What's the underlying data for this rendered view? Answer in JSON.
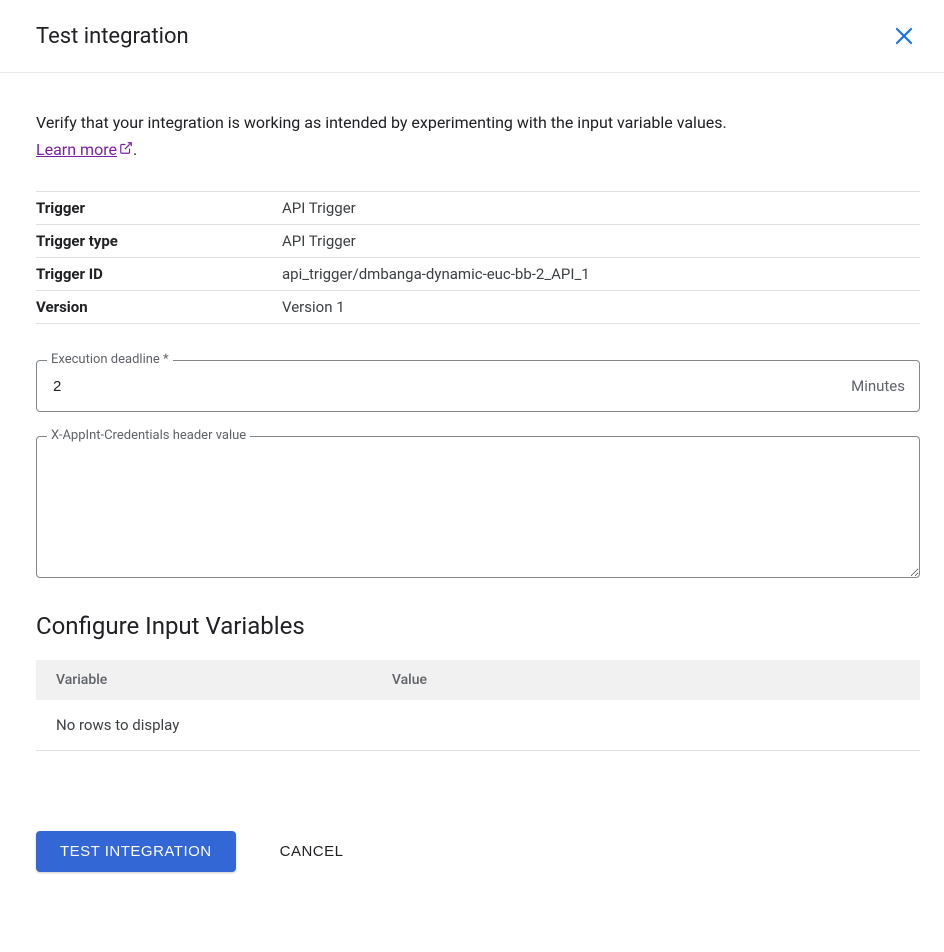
{
  "header": {
    "title": "Test integration"
  },
  "description": {
    "text_before_link": "Verify that your integration is working as intended by experimenting with the input variable values. ",
    "link_text": "Learn more",
    "text_after_link": "."
  },
  "info": {
    "trigger_label": "Trigger",
    "trigger_value": "API Trigger",
    "trigger_type_label": "Trigger type",
    "trigger_type_value": "API Trigger",
    "trigger_id_label": "Trigger ID",
    "trigger_id_value": "api_trigger/dmbanga-dynamic-euc-bb-2_API_1",
    "version_label": "Version",
    "version_value": "Version 1"
  },
  "execution": {
    "label": "Execution deadline *",
    "value": "2",
    "suffix": "Minutes"
  },
  "credentials": {
    "label": "X-AppInt-Credentials header value",
    "value": ""
  },
  "input_vars": {
    "heading": "Configure Input Variables",
    "col_variable": "Variable",
    "col_value": "Value",
    "empty_text": "No rows to display"
  },
  "actions": {
    "primary": "Test Integration",
    "cancel": "Cancel"
  }
}
